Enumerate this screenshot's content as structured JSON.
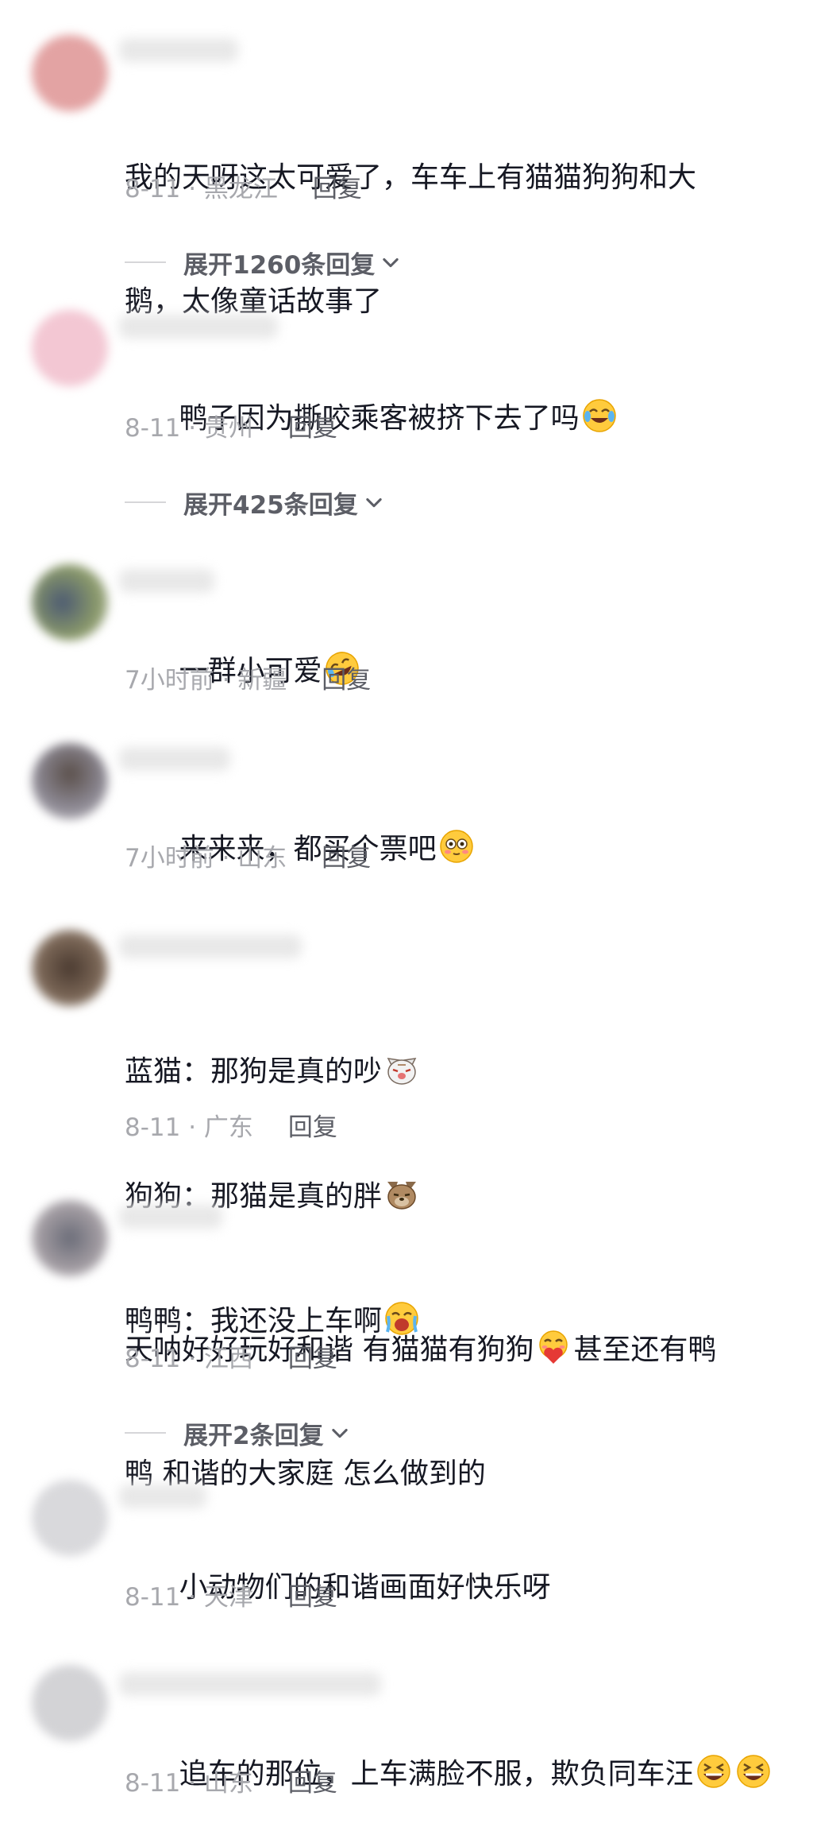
{
  "comments": [
    {
      "text_line1": "我的天呀这太可爱了，车车上有猫猫狗狗和大",
      "text_line2": "鹅，太像童话故事了",
      "meta": "8-11 · 黑龙江",
      "reply": "回复",
      "expand": "展开1260条回复",
      "avatar_color": "#e8a8a8"
    },
    {
      "text": "鸭子因为撕咬乘客被挤下去了吗",
      "emoji": "crying-laughing-emoji",
      "meta": "8-11 · 贵州",
      "reply": "回复",
      "expand": "展开425条回复",
      "avatar_color": "#f3c7d3"
    },
    {
      "text": "一群小可爱",
      "emoji": "rofl-emoji",
      "meta": "7小时前 · 新疆",
      "reply": "回复",
      "avatar_color": "#6d7a6a"
    },
    {
      "text": "来来来，都买个票吧",
      "emoji": "flushed-emoji",
      "meta": "7小时前 · 山东",
      "reply": "回复",
      "avatar_color": "#76727a"
    },
    {
      "line1": "蓝猫：那狗是真的吵",
      "line2": "狗狗：那猫是真的胖",
      "line3": "鸭鸭：我还没上车啊",
      "emoji1": "cat-face-emoji",
      "emoji2": "dog-face-emoji",
      "emoji3": "screaming-crying-emoji",
      "meta": "8-11 · 广东",
      "reply": "回复",
      "avatar_color": "#6e5a4e"
    },
    {
      "line1a": "天呐好好玩好和谐 有猫猫有狗狗",
      "line1b": "甚至还有鸭",
      "line2": "鸭 和谐的大家庭 怎么做到的",
      "emoji": "heart-hugging-emoji",
      "meta": "8-11 · 江西",
      "reply": "回复",
      "expand": "展开2条回复",
      "avatar_color": "#8a8c95"
    },
    {
      "text": "小动物们的和谐画面好快乐呀",
      "meta": "8-11 · 天津",
      "reply": "回复",
      "avatar_color": "#d5d5d8"
    },
    {
      "text": "追车的那位，上车满脸不服，欺负同车汪",
      "emoji": "grinning-squint-emoji",
      "meta": "8-11 · 山东",
      "reply": "回复",
      "avatar_color": "#d0d0d3"
    }
  ]
}
